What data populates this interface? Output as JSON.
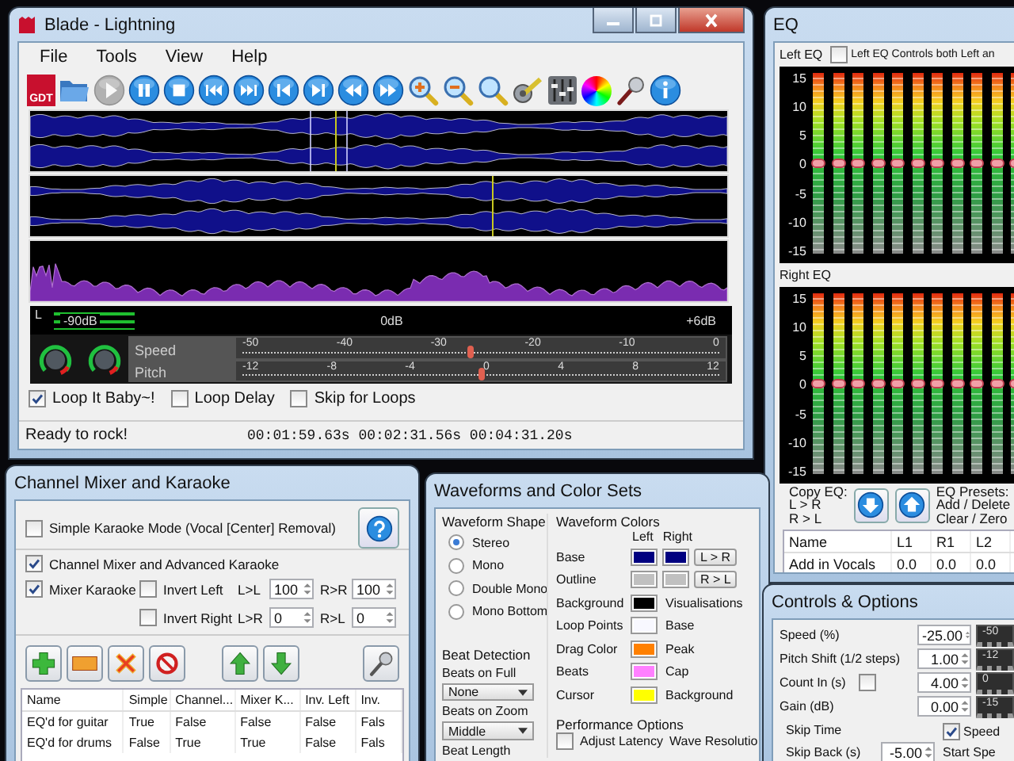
{
  "main_window": {
    "title": "Blade - Lightning",
    "menu": [
      "File",
      "Tools",
      "View",
      "Help"
    ],
    "toolbar": [
      {
        "kind": "logo",
        "label": "GDT",
        "disabled": false
      },
      {
        "kind": "folder",
        "disabled": false
      },
      {
        "kind": "play",
        "disabled": true
      },
      {
        "kind": "pause",
        "disabled": false
      },
      {
        "kind": "stop",
        "disabled": false
      },
      {
        "kind": "first",
        "disabled": false
      },
      {
        "kind": "last",
        "disabled": false
      },
      {
        "kind": "prev",
        "disabled": false
      },
      {
        "kind": "next",
        "disabled": false
      },
      {
        "kind": "rewind",
        "disabled": false
      },
      {
        "kind": "forward",
        "disabled": false
      },
      {
        "kind": "zoom-in",
        "disabled": false
      },
      {
        "kind": "zoom-out",
        "disabled": false
      },
      {
        "kind": "zoom",
        "disabled": false
      },
      {
        "kind": "tools",
        "disabled": false
      },
      {
        "kind": "equalizer",
        "disabled": false
      },
      {
        "kind": "color",
        "disabled": false
      },
      {
        "kind": "mic",
        "disabled": false
      },
      {
        "kind": "info",
        "disabled": false
      }
    ],
    "meter": {
      "channel": "L",
      "level": 0.12,
      "scale": [
        "-90dB",
        "0dB",
        "+6dB"
      ]
    },
    "sliders": [
      {
        "label": "Speed",
        "ticks": [
          "-50",
          "-40",
          "-30",
          "-20",
          "-10",
          "0"
        ],
        "level": 0.48
      },
      {
        "label": "Pitch",
        "ticks": [
          "-12",
          "-8",
          "-4",
          "0",
          "4",
          "8",
          "12"
        ],
        "level": 0.5
      }
    ],
    "options": [
      {
        "label": "Loop It Baby~!",
        "checked": true
      },
      {
        "label": "Loop Delay",
        "checked": false
      },
      {
        "label": "Skip for Loops",
        "checked": false
      }
    ],
    "status": {
      "message": "Ready to rock!",
      "times": "00:01:59.63s 00:02:31.56s 00:04:31.20s"
    }
  },
  "eq_window": {
    "title": "EQ",
    "panels": [
      {
        "label": "Left EQ",
        "option": {
          "label": "Left EQ Controls both Left an",
          "checked": false
        },
        "scale": [
          "15",
          "10",
          "5",
          "0",
          "-5",
          "-10",
          "-15"
        ],
        "bands": [
          {
            "level": 0.5
          },
          {
            "level": 0.5
          },
          {
            "level": 0.5
          },
          {
            "level": 0.5
          },
          {
            "level": 0.5
          },
          {
            "level": 0.5
          },
          {
            "level": 0.5
          },
          {
            "level": 0.5
          },
          {
            "level": 0.5
          },
          {
            "level": 0.5
          },
          {
            "level": 0.5
          }
        ]
      },
      {
        "label": "Right EQ",
        "scale": [
          "15",
          "10",
          "5",
          "0",
          "-5",
          "-10",
          "-15"
        ],
        "bands": [
          {
            "level": 0.5
          },
          {
            "level": 0.5
          },
          {
            "level": 0.5
          },
          {
            "level": 0.5
          },
          {
            "level": 0.5
          },
          {
            "level": 0.5
          },
          {
            "level": 0.5
          },
          {
            "level": 0.5
          },
          {
            "level": 0.5
          },
          {
            "level": 0.5
          },
          {
            "level": 0.5
          }
        ]
      }
    ],
    "copy_lines": [
      "Copy EQ:",
      "L > R",
      "R > L"
    ],
    "preset_lines": [
      "EQ Presets:",
      "Add / Delete",
      "Clear / Zero"
    ],
    "table": {
      "columns": [
        "Name",
        "L1",
        "R1",
        "L2"
      ],
      "rows": [
        [
          "Add in Vocals",
          "0.0",
          "0.0",
          "0.0"
        ]
      ]
    }
  },
  "mixer_window": {
    "title": "Channel Mixer and Karaoke",
    "simple_mode": {
      "label": "Simple Karaoke Mode (Vocal [Center] Removal)",
      "checked": false
    },
    "advanced": {
      "label": "Channel Mixer and Advanced Karaoke",
      "checked": true
    },
    "options": [
      {
        "label": "Mixer Karaoke",
        "checked": true
      },
      {
        "label": "Invert Left",
        "checked": false
      },
      {
        "label": "Invert Right",
        "checked": false
      }
    ],
    "levels": [
      {
        "label": "L>L",
        "value": "100"
      },
      {
        "label": "R>R",
        "value": "100"
      },
      {
        "label": "L>R",
        "value": "0"
      },
      {
        "label": "R>L",
        "value": "0"
      }
    ],
    "tools": [
      {
        "kind": "add"
      },
      {
        "kind": "remove"
      },
      {
        "kind": "delete"
      },
      {
        "kind": "block"
      },
      {
        "kind": "up"
      },
      {
        "kind": "down"
      },
      {
        "kind": "mic"
      }
    ],
    "table": {
      "columns": [
        "Name",
        "Simple",
        "Channel...",
        "Mixer K...",
        "Inv. Left",
        "Inv."
      ],
      "rows": [
        [
          "EQ'd for guitar",
          "True",
          "False",
          "False",
          "False",
          "Fals"
        ],
        [
          "EQ'd for drums",
          "False",
          "True",
          "True",
          "False",
          "Fals"
        ]
      ]
    }
  },
  "waveforms_window": {
    "title": "Waveforms and Color Sets",
    "shape": {
      "title": "Waveform Shape",
      "options": [
        {
          "label": "Stereo",
          "selected": true
        },
        {
          "label": "Mono",
          "selected": false
        },
        {
          "label": "Double Mono",
          "selected": false
        },
        {
          "label": "Mono Bottom",
          "selected": false
        }
      ]
    },
    "beats": {
      "title": "Beat Detection",
      "fields": [
        {
          "label": "Beats on Full",
          "value": "None"
        },
        {
          "label": "Beats on Zoom",
          "value": "Middle"
        }
      ],
      "extra": "Beat Length"
    },
    "colors": {
      "title": "Waveform Colors",
      "headers": [
        "Left",
        "Right"
      ],
      "rows": [
        {
          "label": "Base",
          "swatches": [
            {
              "color": "#000080"
            },
            {
              "color": "#000080"
            }
          ]
        },
        {
          "label": "Outline",
          "swatches": [
            {
              "color": "#c0c0c0"
            },
            {
              "color": "#c0c0c0"
            }
          ]
        },
        {
          "label": "Background",
          "swatches": [
            {
              "color": "#000000"
            }
          ]
        },
        {
          "label": "Loop Points",
          "swatches": [
            {
              "color": "#f8f8ff"
            }
          ]
        },
        {
          "label": "Drag Color",
          "swatches": [
            {
              "color": "#ff8000"
            }
          ]
        },
        {
          "label": "Beats",
          "swatches": [
            {
              "color": "#ff80ff"
            }
          ]
        },
        {
          "label": "Cursor",
          "swatches": [
            {
              "color": "#ffff00"
            }
          ]
        }
      ],
      "buttons": [
        "L > R",
        "R > L"
      ]
    },
    "visualisations": {
      "title": "Visualisations",
      "items": [
        "Base",
        "Peak",
        "Cap",
        "Background"
      ]
    },
    "performance": {
      "title": "Performance Options",
      "option": {
        "label": "Adjust Latency",
        "checked": false
      },
      "extra": "Wave Resolutio"
    }
  },
  "controls_window": {
    "title": "Controls & Options",
    "rows": [
      {
        "kind": "plain",
        "label": "Speed (%)",
        "value": "-25.00",
        "tick": "-50"
      },
      {
        "kind": "plain",
        "label": "Pitch Shift (1/2 steps)",
        "value": "1.00",
        "tick": "-12"
      },
      {
        "kind": "check",
        "label": "Count In (s)",
        "checked": false,
        "value": "4.00",
        "tick": "0"
      },
      {
        "kind": "plain",
        "label": "Gain (dB)",
        "value": "0.00",
        "tick": "-15"
      }
    ],
    "skip": {
      "title": "Skip Time",
      "label": "Skip Back (s)",
      "value": "-5.00"
    },
    "speed_option": {
      "label": "Speed",
      "checked": true
    },
    "start_label": "Start Spe"
  }
}
